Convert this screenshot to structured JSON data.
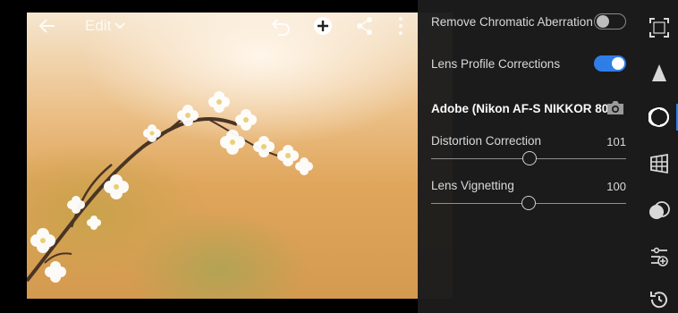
{
  "toolbar": {
    "edit_label": "Edit"
  },
  "panel": {
    "chromatic": {
      "label": "Remove Chromatic Aberration",
      "enabled": false
    },
    "profile_corrections": {
      "label": "Lens Profile Corrections",
      "enabled": true
    },
    "lens_profile": "Adobe (Nikon AF-S NIKKOR 80-...",
    "distortion": {
      "label": "Distortion Correction",
      "value": "101"
    },
    "vignetting": {
      "label": "Lens Vignetting",
      "value": "100"
    }
  },
  "rail": {
    "tools": [
      "crop-icon",
      "light-icon",
      "optics-icon",
      "geometry-icon",
      "blend-icon",
      "presets-icon",
      "history-icon"
    ],
    "active": "optics-icon"
  },
  "colors": {
    "accent": "#2f7ee8",
    "panel": "#1c1c1c"
  }
}
